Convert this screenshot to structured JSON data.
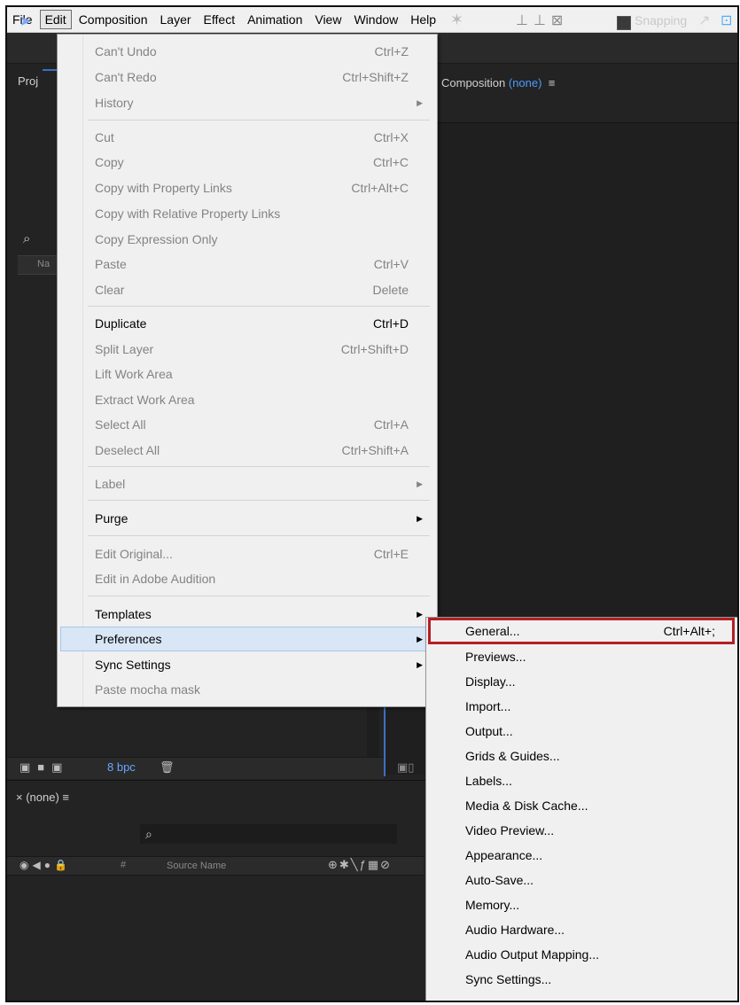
{
  "menubar": {
    "items": [
      "File",
      "Edit",
      "Composition",
      "Layer",
      "Effect",
      "Animation",
      "View",
      "Window",
      "Help"
    ],
    "active": "Edit"
  },
  "toolbar": {
    "snapping_label": "Snapping"
  },
  "project_panel": {
    "tab_label": "Proj",
    "column_header": "Na",
    "bpc": "8 bpc"
  },
  "composition_panel": {
    "tab_prefix": "Composition ",
    "tab_value": "(none)",
    "menu_glyph": "≡"
  },
  "timeline": {
    "tab_label": "× (none) ≡",
    "source_name_header": "Source Name",
    "hash": "#"
  },
  "edit_menu": {
    "items": [
      {
        "label": "Can't Undo",
        "shortcut": "Ctrl+Z",
        "disabled": true
      },
      {
        "label": "Can't Redo",
        "shortcut": "Ctrl+Shift+Z",
        "disabled": true
      },
      {
        "label": "History",
        "shortcut": "",
        "disabled": true,
        "submenu": true
      },
      {
        "label": "Cut",
        "shortcut": "Ctrl+X",
        "disabled": true
      },
      {
        "label": "Copy",
        "shortcut": "Ctrl+C",
        "disabled": true
      },
      {
        "label": "Copy with Property Links",
        "shortcut": "Ctrl+Alt+C",
        "disabled": true
      },
      {
        "label": "Copy with Relative Property Links",
        "shortcut": "",
        "disabled": true
      },
      {
        "label": "Copy Expression Only",
        "shortcut": "",
        "disabled": true
      },
      {
        "label": "Paste",
        "shortcut": "Ctrl+V",
        "disabled": true
      },
      {
        "label": "Clear",
        "shortcut": "Delete",
        "disabled": true
      },
      {
        "label": "Duplicate",
        "shortcut": "Ctrl+D",
        "disabled": false
      },
      {
        "label": "Split Layer",
        "shortcut": "Ctrl+Shift+D",
        "disabled": true
      },
      {
        "label": "Lift Work Area",
        "shortcut": "",
        "disabled": true
      },
      {
        "label": "Extract Work Area",
        "shortcut": "",
        "disabled": true
      },
      {
        "label": "Select All",
        "shortcut": "Ctrl+A",
        "disabled": true
      },
      {
        "label": "Deselect All",
        "shortcut": "Ctrl+Shift+A",
        "disabled": true
      },
      {
        "label": "Label",
        "shortcut": "",
        "disabled": true,
        "submenu": true
      },
      {
        "label": "Purge",
        "shortcut": "",
        "disabled": false,
        "submenu": true
      },
      {
        "label": "Edit Original...",
        "shortcut": "Ctrl+E",
        "disabled": true
      },
      {
        "label": "Edit in Adobe Audition",
        "shortcut": "",
        "disabled": true
      },
      {
        "label": "Templates",
        "shortcut": "",
        "disabled": false,
        "submenu": true
      },
      {
        "label": "Preferences",
        "shortcut": "",
        "disabled": false,
        "submenu": true,
        "highlighted": true
      },
      {
        "label": "Sync Settings",
        "shortcut": "",
        "disabled": false,
        "submenu": true
      },
      {
        "label": "Paste mocha mask",
        "shortcut": "",
        "disabled": true
      }
    ],
    "arrow_glyph": "▶"
  },
  "preferences_menu": {
    "items": [
      {
        "label": "General...",
        "shortcut": "Ctrl+Alt+;"
      },
      {
        "label": "Previews...",
        "shortcut": ""
      },
      {
        "label": "Display...",
        "shortcut": ""
      },
      {
        "label": "Import...",
        "shortcut": ""
      },
      {
        "label": "Output...",
        "shortcut": ""
      },
      {
        "label": "Grids & Guides...",
        "shortcut": ""
      },
      {
        "label": "Labels...",
        "shortcut": ""
      },
      {
        "label": "Media & Disk Cache...",
        "shortcut": ""
      },
      {
        "label": "Video Preview...",
        "shortcut": ""
      },
      {
        "label": "Appearance...",
        "shortcut": ""
      },
      {
        "label": "Auto-Save...",
        "shortcut": ""
      },
      {
        "label": "Memory...",
        "shortcut": ""
      },
      {
        "label": "Audio Hardware...",
        "shortcut": ""
      },
      {
        "label": "Audio Output Mapping...",
        "shortcut": ""
      },
      {
        "label": "Sync Settings...",
        "shortcut": ""
      }
    ],
    "highlight_color": "#b51e24"
  }
}
